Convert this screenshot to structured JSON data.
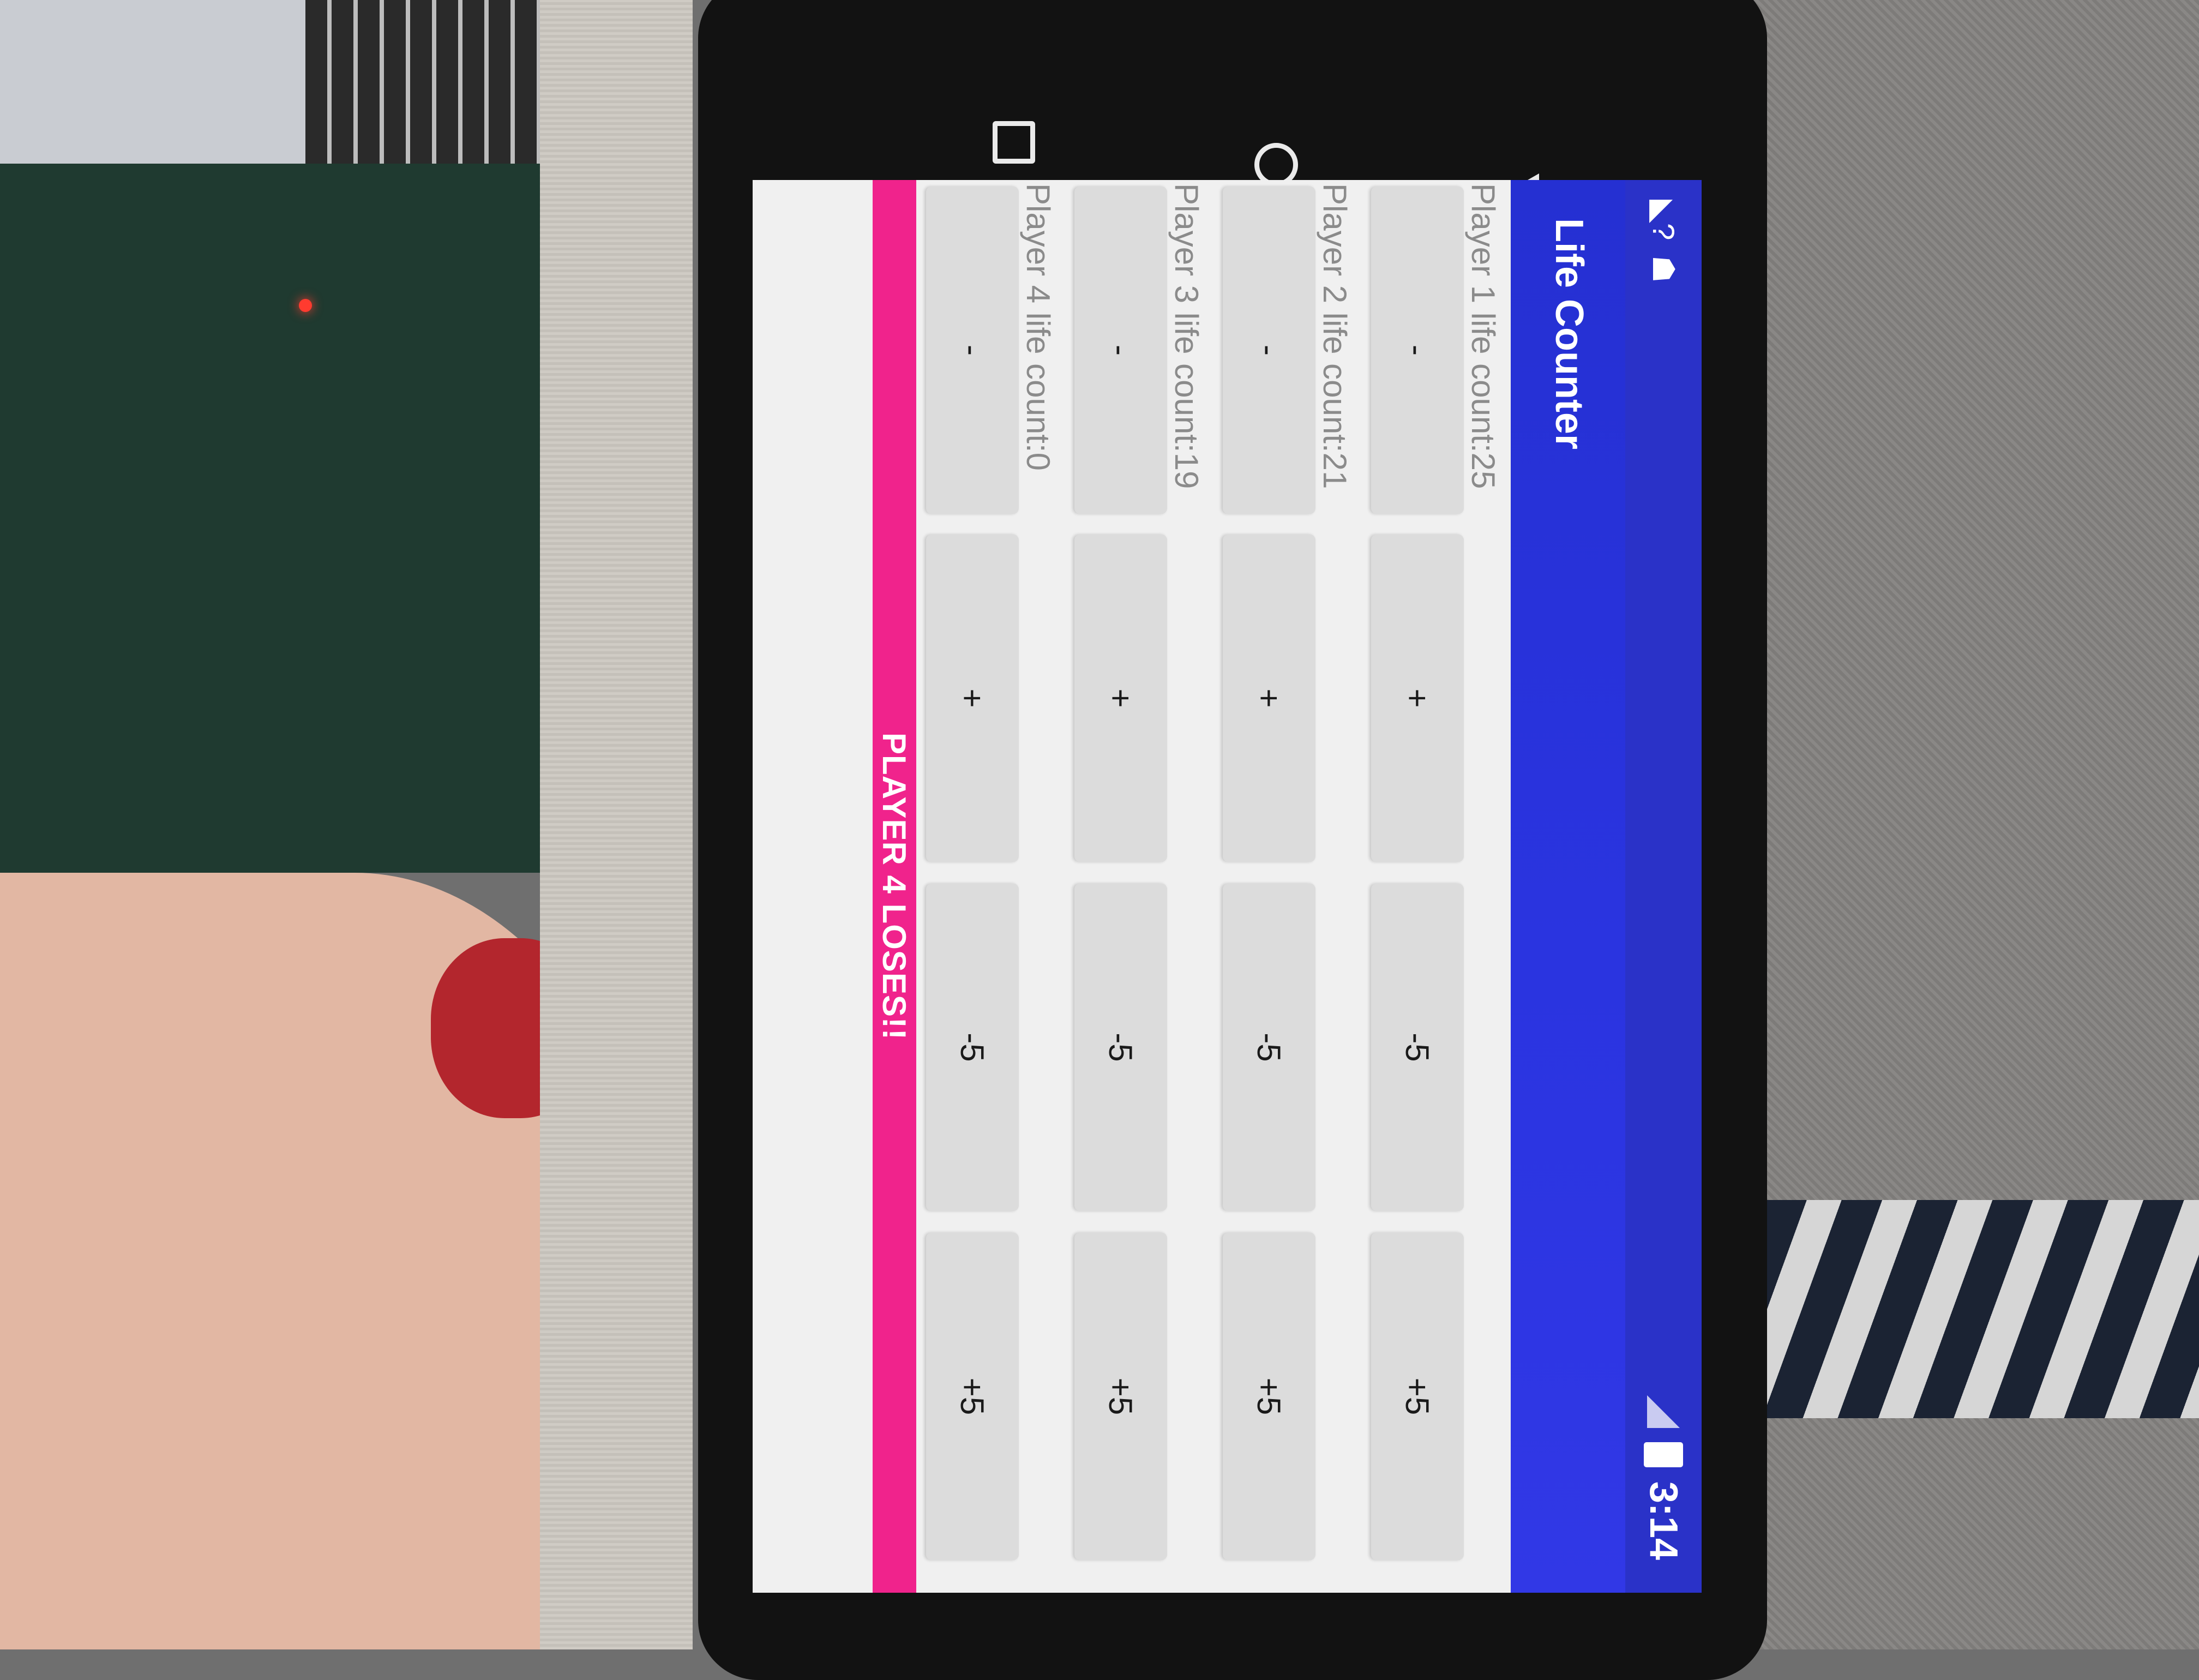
{
  "status_bar": {
    "time": "3:14",
    "left_icons": [
      "wifi-question-icon",
      "android-debug-icon"
    ],
    "right_icons": [
      "no-signal-icon",
      "battery-charging-icon"
    ]
  },
  "app": {
    "title": "Life Counter",
    "colors": {
      "app_bar": "#2a34e0",
      "lose_banner": "#f0238c",
      "button": "#dcdcdc"
    }
  },
  "players": [
    {
      "label": "Player 1 life count:25",
      "buttons": [
        "-",
        "+",
        "-5",
        "+5"
      ]
    },
    {
      "label": "Player 2 life count:21",
      "buttons": [
        "-",
        "+",
        "-5",
        "+5"
      ]
    },
    {
      "label": "Player 3 life count:19",
      "buttons": [
        "-",
        "+",
        "-5",
        "+5"
      ]
    },
    {
      "label": "Player 4 life count:0",
      "buttons": [
        "-",
        "+",
        "-5",
        "+5"
      ]
    }
  ],
  "status_message": "PLAYER 4 LOSES!!",
  "nav_bar": {
    "buttons": [
      "recents-icon",
      "home-icon",
      "back-icon"
    ]
  }
}
